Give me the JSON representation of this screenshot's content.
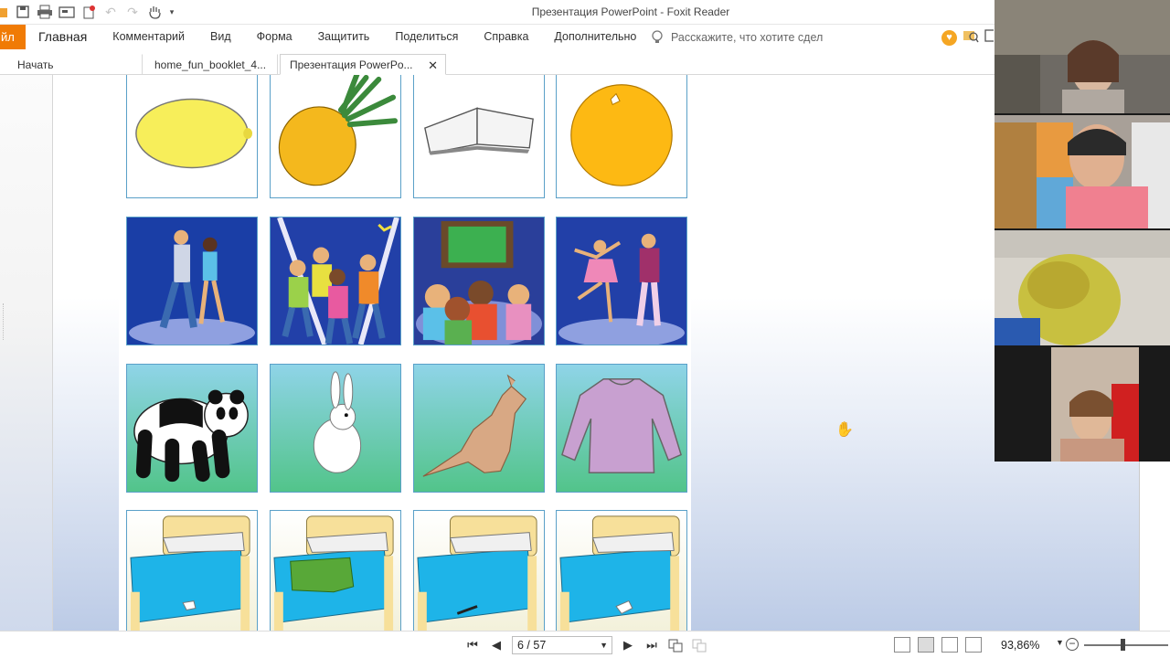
{
  "window": {
    "title": "Презентация PowerPoint - Foxit Reader"
  },
  "quick_access": {
    "icons": [
      "folder-icon",
      "save-icon",
      "print-icon",
      "screenshot-icon",
      "new-icon",
      "undo-icon",
      "redo-icon",
      "hand-tool-icon",
      "dropdown-icon"
    ]
  },
  "ribbon": {
    "file_label": "йл",
    "menu": [
      "Главная",
      "Комментарий",
      "Вид",
      "Форма",
      "Защитить",
      "Поделиться",
      "Справка",
      "Дополнительно"
    ],
    "tell_me_placeholder": "Расскажите, что хотите сдел"
  },
  "tabs": [
    {
      "label": "Начать"
    },
    {
      "label": "home_fun_booklet_4..."
    },
    {
      "label": "Презентация PowerPo...",
      "close": "✕"
    }
  ],
  "document": {
    "grid": [
      [
        "lemon",
        "pineapple",
        "book",
        "orange"
      ],
      [
        "couple dancing",
        "disco dancing",
        "children watching TV",
        "ballet"
      ],
      [
        "panda",
        "rabbit",
        "kangaroo",
        "jumper"
      ],
      [
        "bed with sock",
        "bed with clothes",
        "bed with pencil",
        "bed with sock on floor"
      ]
    ]
  },
  "status": {
    "page_value": "6 / 57",
    "zoom": "93,86%",
    "zoom_level_fraction": 0.45
  },
  "colors": {
    "accent": "#f07b05",
    "cell_border": "#5aa0c8"
  }
}
